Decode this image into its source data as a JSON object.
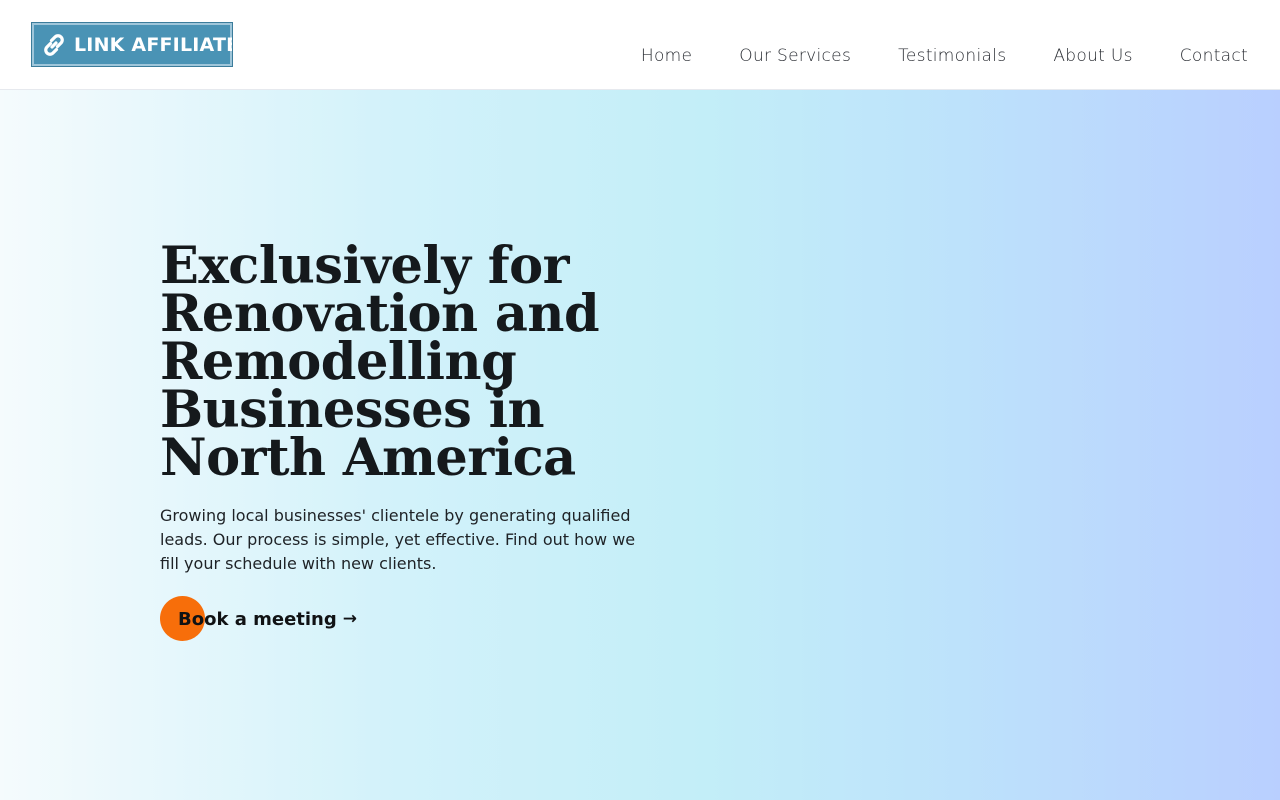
{
  "header": {
    "logo": {
      "text": "LINK AFFILIATES",
      "icon": "chain-link-icon",
      "bg_color": "#4a93b5"
    },
    "nav": [
      {
        "label": "Home"
      },
      {
        "label": "Our Services"
      },
      {
        "label": "Testimonials"
      },
      {
        "label": "About Us"
      },
      {
        "label": "Contact"
      }
    ]
  },
  "hero": {
    "title": "Exclusively for Renovation and Remodelling Businesses in North America",
    "subtitle": "Growing local businesses' clientele by generating qualified leads. Our process is simple, yet effective. Find out how we fill your schedule with new clients.",
    "cta": {
      "label": "Book a meeting",
      "arrow": "→",
      "icon": "arrow-right-icon",
      "accent_color": "#f76e0a"
    }
  }
}
